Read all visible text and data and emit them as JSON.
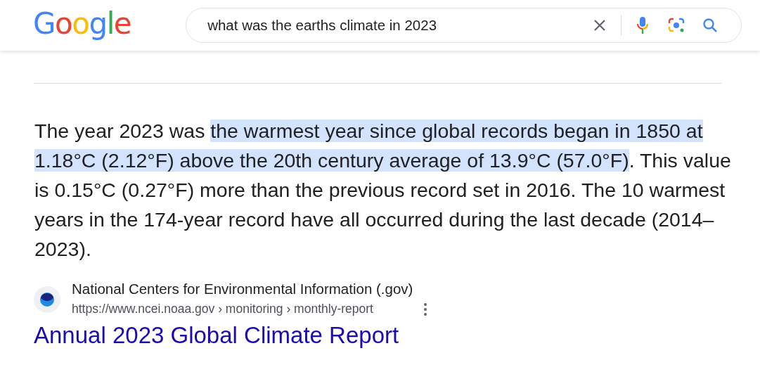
{
  "logo": "Google",
  "search": {
    "value": "what was the earths climate in 2023"
  },
  "snippet": {
    "before": "The year 2023 was ",
    "highlight": "the warmest year since global records began in 1850 at 1.18°C (2.12°F) above the 20th century average of 13.9°C (57.0°F)",
    "after": ". This value is 0.15°C (0.27°F) more than the previous record set in 2016. The 10 warmest years in the 174-year record have all occurred during the last decade (2014–2023)."
  },
  "source": {
    "site_name": "National Centers for Environmental Information (.gov)",
    "url": "https://www.ncei.noaa.gov › monitoring › monthly-report",
    "title": "Annual 2023 Global Climate Report"
  }
}
